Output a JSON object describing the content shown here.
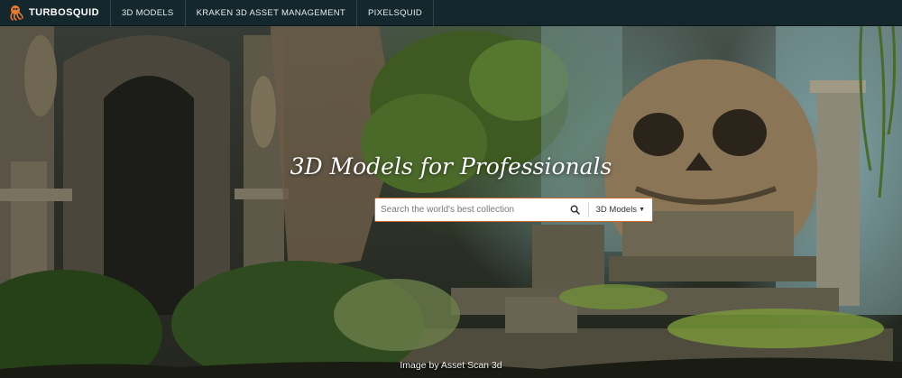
{
  "brand": {
    "name": "TURBOSQUID",
    "logo_icon": "squid-logo-icon",
    "accent": "#e87a2f"
  },
  "nav": {
    "links": [
      {
        "label": "3D MODELS"
      },
      {
        "label": "KRAKEN 3D ASSET MANAGEMENT"
      },
      {
        "label": "PIXELSQUID"
      }
    ]
  },
  "hero": {
    "title": "3D Models for Professionals",
    "search": {
      "placeholder": "Search the world's best collection",
      "search_icon": "search-icon",
      "category": "3D Models",
      "category_icon": "caret-down-icon"
    },
    "credit": "Image by Asset Scan 3d"
  },
  "colors": {
    "topbar_bg": "#14272c",
    "search_border": "#c9693a"
  }
}
